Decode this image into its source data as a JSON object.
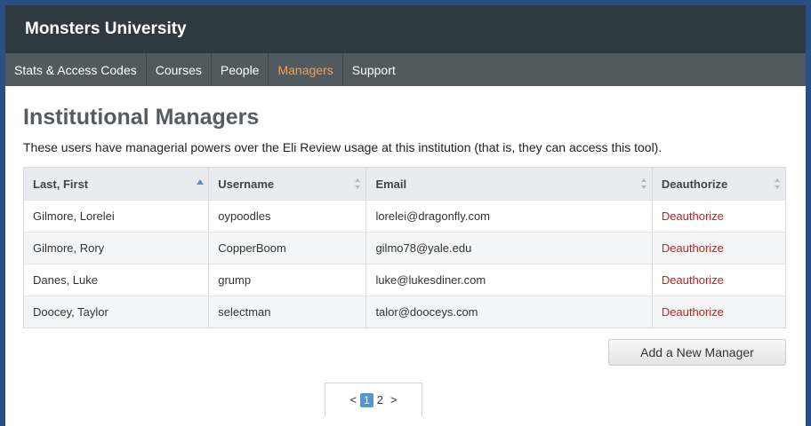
{
  "header": {
    "brand": "Monsters University"
  },
  "nav": {
    "items": [
      {
        "label": "Stats & Access Codes"
      },
      {
        "label": "Courses"
      },
      {
        "label": "People"
      },
      {
        "label": "Managers",
        "active": true
      },
      {
        "label": "Support"
      }
    ]
  },
  "page": {
    "title": "Institutional Managers",
    "description": "These users have managerial powers over the Eli Review usage at this institution (that is, they can access this tool)."
  },
  "table": {
    "columns": [
      "Last, First",
      "Username",
      "Email",
      "Deauthorize"
    ],
    "rows": [
      {
        "name": "Gilmore, Lorelei",
        "username": "oypoodles",
        "email": "lorelei@dragonfly.com",
        "action": "Deauthorize"
      },
      {
        "name": "Gilmore, Rory",
        "username": "CopperBoom",
        "email": "gilmo78@yale.edu",
        "action": "Deauthorize"
      },
      {
        "name": "Danes, Luke",
        "username": "grump",
        "email": "luke@lukesdiner.com",
        "action": "Deauthorize"
      },
      {
        "name": "Doocey, Taylor",
        "username": "selectman",
        "email": "talor@dooceys.com",
        "action": "Deauthorize"
      }
    ]
  },
  "actions": {
    "add_label": "Add a New Manager"
  },
  "pagination": {
    "prev": "<",
    "pages": [
      "1",
      "2"
    ],
    "current": "1",
    "next": ">"
  },
  "colors": {
    "accent_nav": "#f0a05a",
    "deauthorize": "#c4201e",
    "pager_current": "#4a99d8",
    "topbar": "#2f3a40",
    "navbar": "#505a5f"
  },
  "icons": {
    "sort_active": "sort-ascending-icon",
    "sort_inactive": "sort-both-icon"
  }
}
